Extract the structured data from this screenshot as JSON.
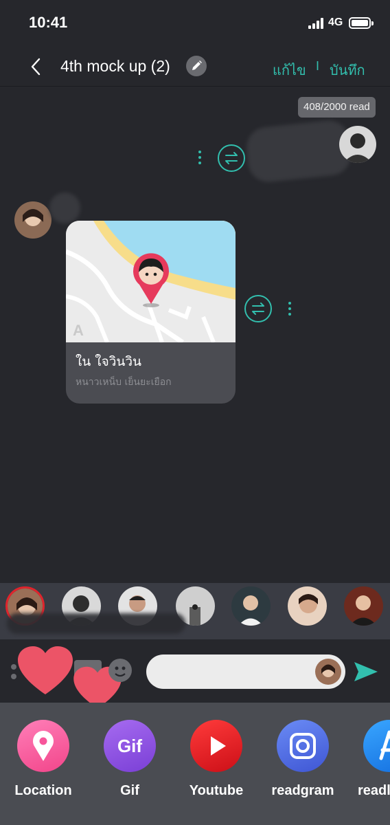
{
  "status_bar": {
    "time": "10:41",
    "network": "4G"
  },
  "header": {
    "title": "4th mock up (2)",
    "edit_label": "แก้ไข",
    "separator": "I",
    "save_label": "บันทึก"
  },
  "chat": {
    "read_counter": "408/2000 read",
    "location_card": {
      "name": "ใน ใจวินวิน",
      "address": "หนาวเหน็บ เย็นยะเยือก",
      "map_letter": "A"
    }
  },
  "tray": {
    "items": [
      {
        "label": "Location",
        "icon": "location-pin-icon"
      },
      {
        "label": "Gif",
        "icon": "gif-icon"
      },
      {
        "label": "Youtube",
        "icon": "youtube-play-icon"
      },
      {
        "label": "readgram",
        "icon": "camera-icon"
      },
      {
        "label": "readl",
        "icon": "app-store-icon"
      }
    ]
  },
  "colors": {
    "accent": "#32bfae",
    "background": "#26272c",
    "tray": "#4a4c52",
    "location": "#f7559a",
    "gif": "#8a52e0",
    "youtube": "#e51b23",
    "readgram": "#4b6fe0",
    "appstore": "#1e8ef0"
  }
}
